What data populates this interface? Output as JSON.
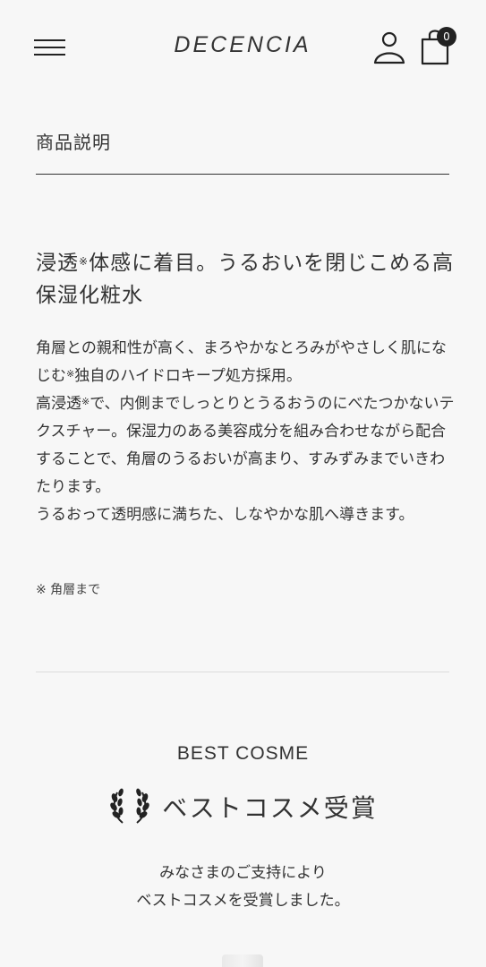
{
  "header": {
    "logo": "DECENCIA",
    "cart_count": "0"
  },
  "section": {
    "title": "商品説明"
  },
  "headline": {
    "part1": "浸透",
    "mark": "※",
    "part2": "体感に着目。うるおいを閉じこめる高保湿化粧水"
  },
  "body": {
    "p1_a": "角層との親和性が高く、まろやかなとろみがやさしく肌になじむ",
    "p1_mark": "※",
    "p1_b": "独自のハイドロキープ処方採用。",
    "p2_a": "高浸透",
    "p2_mark": "※",
    "p2_b": "で、内側までしっとりとうるおうのにべたつかないテクスチャー。保湿力のある美容成分を組み合わせながら配合することで、角層のうるおいが高まり、すみずみまでいきわたります。",
    "p3": "うるおって透明感に満ちた、しなやかな肌へ導きます。"
  },
  "note": "※ 角層まで",
  "award": {
    "label_en": "BEST COSME",
    "title": "ベストコスメ受賞",
    "line1": "みなさまのご支持により",
    "line2": "ベストコスメを受賞しました。"
  },
  "icons": {
    "menu": "hamburger-icon",
    "account": "user-icon",
    "cart": "shopping-bag-icon",
    "award": "laurel-wreath-icon"
  }
}
